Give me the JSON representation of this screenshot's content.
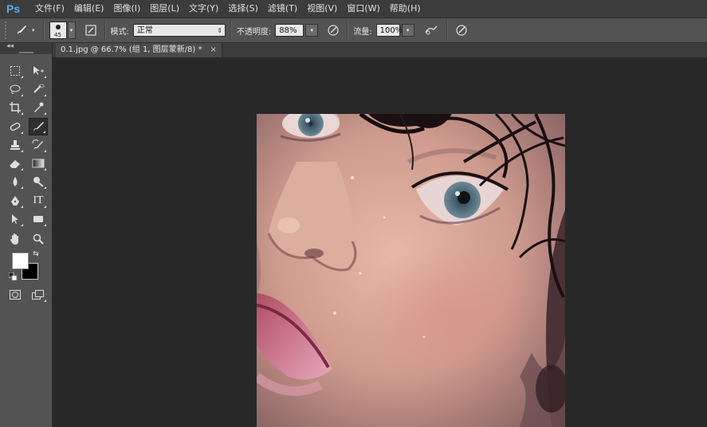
{
  "app": {
    "logo": "Ps",
    "accent": "#4fb0ec"
  },
  "menu": [
    "文件(F)",
    "编辑(E)",
    "图像(I)",
    "图层(L)",
    "文字(Y)",
    "选择(S)",
    "滤镜(T)",
    "视图(V)",
    "窗口(W)",
    "帮助(H)"
  ],
  "options": {
    "brush_size": "45",
    "mode_label": "模式:",
    "mode_value": "正常",
    "opacity_label": "不透明度:",
    "opacity_value": "88%",
    "flow_label": "流量:",
    "flow_value": "100%"
  },
  "toolbox": {
    "collapse": "◂◂"
  },
  "colors": {
    "foreground": "#ffffff",
    "background": "#000000"
  },
  "document": {
    "tab_title": "0.1.jpg @ 66.7% (组 1, 图层蒙新/8) *",
    "close": "×"
  },
  "image": {
    "subject": "close-up portrait photo"
  }
}
